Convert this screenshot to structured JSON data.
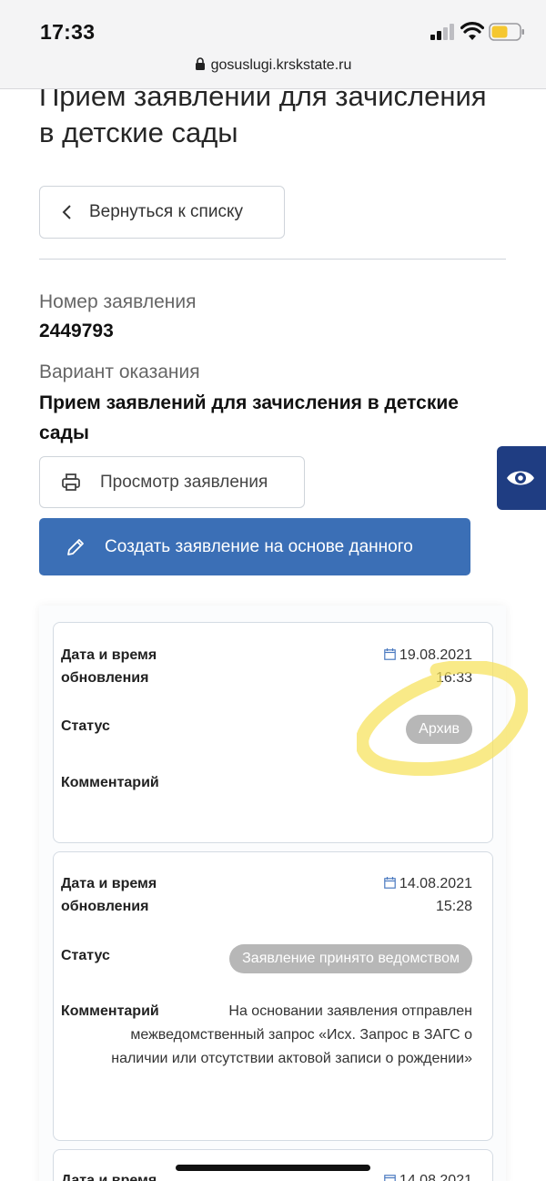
{
  "status_bar": {
    "time": "17:33"
  },
  "browser": {
    "url": "gosuslugi.krskstate.ru"
  },
  "page": {
    "title_line1": "Прием заявлений для зачисления",
    "title_line2": "в детские сады",
    "back_button": "Вернуться к списку"
  },
  "application": {
    "number_label": "Номер заявления",
    "number_value": "2449793",
    "variant_label": "Вариант оказания",
    "variant_value_line1": "Прием заявлений для зачисления в детские",
    "variant_value_line2": "сады",
    "view_button": "Просмотр заявления",
    "create_button": "Создать заявление на основе данного"
  },
  "labels": {
    "date_line1": "Дата и время",
    "date_line2": "обновления",
    "status": "Статус",
    "comment": "Комментарий"
  },
  "history": [
    {
      "date": "19.08.2021",
      "time": "16:33",
      "status": "Архив",
      "comment": ""
    },
    {
      "date": "14.08.2021",
      "time": "15:28",
      "status": "Заявление принято ведомством",
      "comment_line1": "На основании заявления отправлен",
      "comment_line2": "межведомственный запрос «Исх. Запрос в ЗАГС о",
      "comment_line3": "наличии или отсутствии актовой записи о рождении»"
    },
    {
      "date": "14.08.2021"
    }
  ],
  "colors": {
    "primary": "#3b6fb6",
    "accessibility_tab": "#1f3d82",
    "badge": "#b7b7b7",
    "highlight": "#f7e25a"
  }
}
